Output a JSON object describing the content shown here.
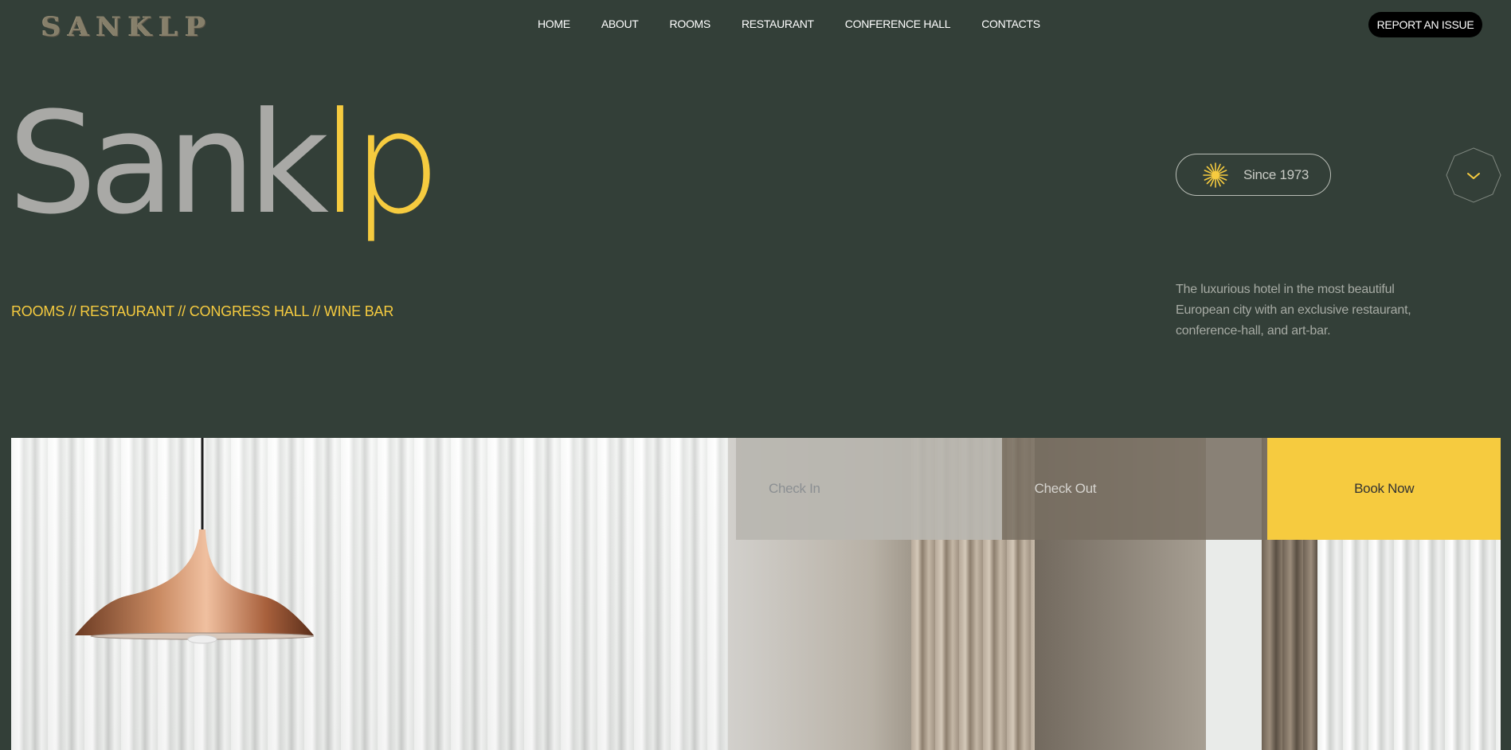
{
  "header": {
    "logo": "SANKLP",
    "nav": [
      "HOME",
      "ABOUT",
      "ROOMS",
      "RESTAURANT",
      "CONFERENCE HALL",
      "CONTACTS"
    ],
    "report_button": "REPORT AN ISSUE"
  },
  "hero": {
    "title_grey": "Sank",
    "title_yellow": "lp",
    "tagline": "ROOMS // RESTAURANT // CONGRESS HALL // WINE BAR",
    "since_label": "Since 1973",
    "description": "The luxurious hotel in the most beautiful European city with an exclusive restaurant, conference-hall, and art-bar."
  },
  "booking": {
    "check_in_placeholder": "Check In",
    "check_out_placeholder": "Check Out",
    "book_button": "Book Now"
  },
  "colors": {
    "background": "#333f38",
    "accent": "#f6cb3f",
    "title_grey": "#a9a9a6"
  },
  "icons": {
    "since": "sparkle-star-icon",
    "scroll": "chevron-down-icon"
  }
}
